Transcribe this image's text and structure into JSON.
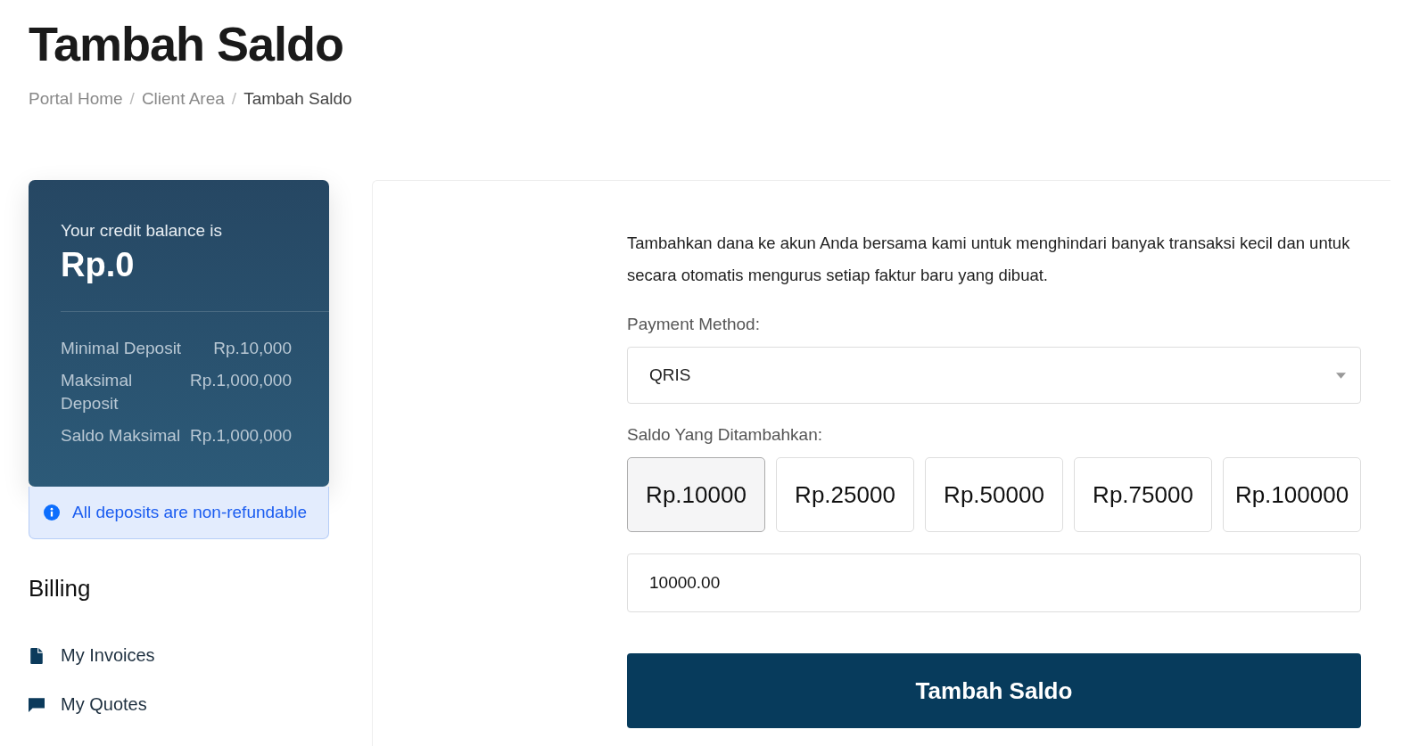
{
  "page_title": "Tambah Saldo",
  "breadcrumb": [
    {
      "label": "Portal Home",
      "current": false
    },
    {
      "label": "Client Area",
      "current": false
    },
    {
      "label": "Tambah Saldo",
      "current": true
    }
  ],
  "breadcrumb_separators": [
    "/",
    "/"
  ],
  "balance_card": {
    "label": "Your credit balance is",
    "amount": "Rp.0",
    "limits": [
      {
        "name": "Minimal Deposit",
        "value": "Rp.10,000"
      },
      {
        "name": "Maksimal Deposit",
        "value": "Rp.1,000,000"
      },
      {
        "name": "Saldo Maksimal",
        "value": "Rp.1,000,000"
      }
    ]
  },
  "notice": "All deposits are non-refundable",
  "sidebar": {
    "heading": "Billing",
    "items": [
      {
        "label": "My Invoices",
        "kind": "invoice"
      },
      {
        "label": "My Quotes",
        "kind": "quote"
      }
    ]
  },
  "form": {
    "intro": "Tambahkan dana ke akun Anda bersama kami untuk menghindari banyak transaksi kecil dan untuk secara otomatis mengurus setiap faktur baru yang dibuat.",
    "payment_label": "Payment Method:",
    "payment_value": "QRIS",
    "amount_label": "Saldo Yang Ditambahkan:",
    "presets": [
      {
        "label": "Rp.10000",
        "selected": true
      },
      {
        "label": "Rp.25000",
        "selected": false
      },
      {
        "label": "Rp.50000",
        "selected": false
      },
      {
        "label": "Rp.75000",
        "selected": false
      },
      {
        "label": "Rp.100000",
        "selected": false
      }
    ],
    "amount_value": "10000.00",
    "submit": "Tambah Saldo"
  }
}
